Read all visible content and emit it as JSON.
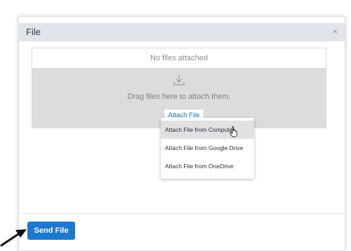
{
  "dialog": {
    "title": "File",
    "close_glyph": "×"
  },
  "files": {
    "empty_text": "No files attached",
    "drop_text": "Drag files here to attach them.",
    "attach_button": "Attach File",
    "drop_icon": "download-icon"
  },
  "attach_menu": {
    "items": [
      {
        "label": "Attach File from Computer",
        "highlighted": true
      },
      {
        "label": "Attach File from Google Drive",
        "highlighted": false
      },
      {
        "label": "Attach File from OneDrive",
        "highlighted": false
      }
    ]
  },
  "footer": {
    "send_button": "Send File"
  },
  "colors": {
    "accent": "#1e78d0",
    "header_bg": "#e1e5ea",
    "dropzone_bg": "#dcdcdc"
  }
}
